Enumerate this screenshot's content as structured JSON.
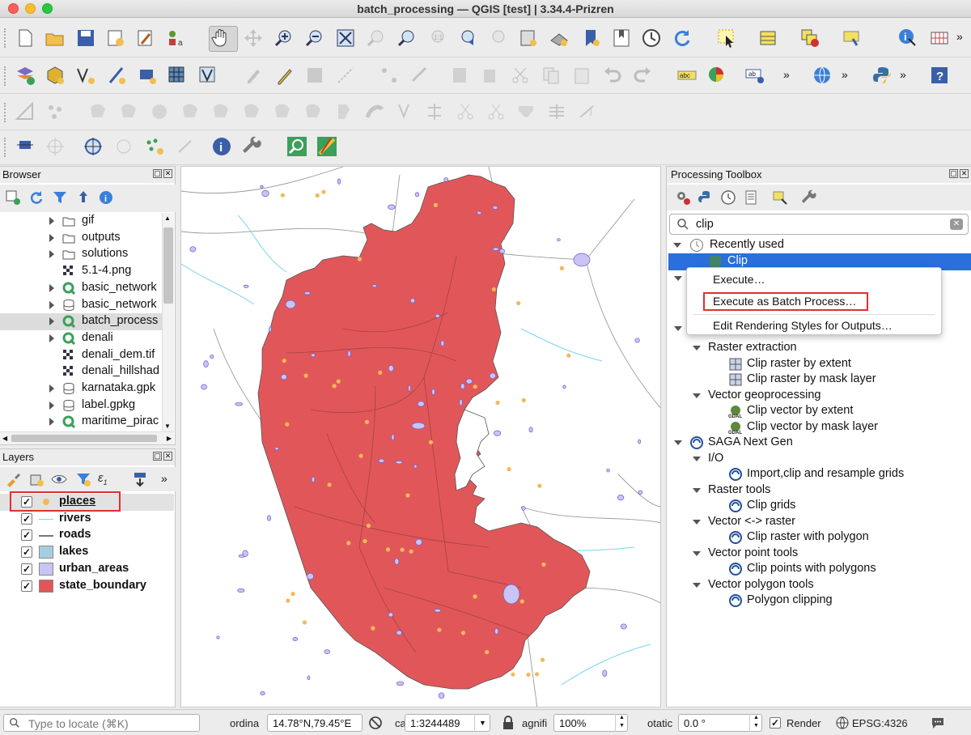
{
  "window": {
    "title": "batch_processing — QGIS [test] | 3.34.4-Prizren"
  },
  "browser": {
    "title": "Browser",
    "items": [
      {
        "label": "gif",
        "icon": "folder-icon"
      },
      {
        "label": "outputs",
        "icon": "folder-icon"
      },
      {
        "label": "solutions",
        "icon": "folder-icon"
      },
      {
        "label": "5.1-4.png",
        "icon": "raster-icon"
      },
      {
        "label": "basic_network",
        "icon": "qgis-project-icon"
      },
      {
        "label": "basic_network",
        "icon": "database-icon"
      },
      {
        "label": "batch_process",
        "icon": "qgis-project-icon"
      },
      {
        "label": "denali",
        "icon": "qgis-project-icon"
      },
      {
        "label": "denali_dem.tif",
        "icon": "raster-icon"
      },
      {
        "label": "denali_hillshad",
        "icon": "raster-icon"
      },
      {
        "label": "karnataka.gpk",
        "icon": "database-icon"
      },
      {
        "label": "label.gpkg",
        "icon": "database-icon"
      },
      {
        "label": "maritime_pirac",
        "icon": "qgis-project-icon"
      }
    ]
  },
  "layers": {
    "title": "Layers",
    "items": [
      {
        "label": "places",
        "checked": true,
        "symbol": "point",
        "color": "#f5b85a"
      },
      {
        "label": "rivers",
        "checked": true,
        "symbol": "line",
        "color": "#7ad6e8"
      },
      {
        "label": "roads",
        "checked": true,
        "symbol": "line",
        "color": "#777777"
      },
      {
        "label": "lakes",
        "checked": true,
        "symbol": "fill",
        "color": "#a6cee3"
      },
      {
        "label": "urban_areas",
        "checked": true,
        "symbol": "fill",
        "color": "#c8c4f4"
      },
      {
        "label": "state_boundary",
        "checked": true,
        "symbol": "fill",
        "color": "#e15759"
      }
    ]
  },
  "toolbox": {
    "title": "Processing Toolbox",
    "search_value": "clip",
    "recently_used": "Recently used",
    "selected_tool": "Clip",
    "groups": [
      {
        "label": "Raster extraction",
        "level": 1
      },
      {
        "label": "Clip raster by extent",
        "level": 2,
        "icon": "raster-tool-icon"
      },
      {
        "label": "Clip raster by mask layer",
        "level": 2,
        "icon": "raster-tool-icon"
      },
      {
        "label": "Vector geoprocessing",
        "level": 1
      },
      {
        "label": "Clip vector by extent",
        "level": 2,
        "icon": "gdal-icon"
      },
      {
        "label": "Clip vector by mask layer",
        "level": 2,
        "icon": "gdal-icon"
      },
      {
        "label": "SAGA Next Gen",
        "level": 0,
        "icon": "saga-icon"
      },
      {
        "label": "I/O",
        "level": 1
      },
      {
        "label": "Import,clip and resample grids",
        "level": 2,
        "icon": "saga-icon"
      },
      {
        "label": "Raster tools",
        "level": 1
      },
      {
        "label": "Clip grids",
        "level": 2,
        "icon": "saga-icon"
      },
      {
        "label": "Vector <-> raster",
        "level": 1
      },
      {
        "label": "Clip raster with polygon",
        "level": 2,
        "icon": "saga-icon"
      },
      {
        "label": "Vector point tools",
        "level": 1
      },
      {
        "label": "Clip points with polygons",
        "level": 2,
        "icon": "saga-icon"
      },
      {
        "label": "Vector polygon tools",
        "level": 1
      },
      {
        "label": "Polygon clipping",
        "level": 2,
        "icon": "saga-icon"
      }
    ]
  },
  "context_menu": {
    "items": [
      "Execute…",
      "Execute as Batch Process…",
      "Edit Rendering Styles for Outputs…"
    ]
  },
  "status": {
    "locate_placeholder": "Type to locate (⌘K)",
    "coordinate_label": "ordina",
    "coordinate_value": "14.78°N,79.45°E",
    "scale_label": "ca",
    "scale_value": "1:3244489",
    "magnifier_label": "agnifi",
    "magnifier_value": "100%",
    "rotation_label": "otatic",
    "rotation_value": "0.0 °",
    "render_label": "Render",
    "crs": "EPSG:4326"
  },
  "colors": {
    "state_fill": "#e15759",
    "selection": "#2a6fdb",
    "highlight_box": "#e03030"
  }
}
